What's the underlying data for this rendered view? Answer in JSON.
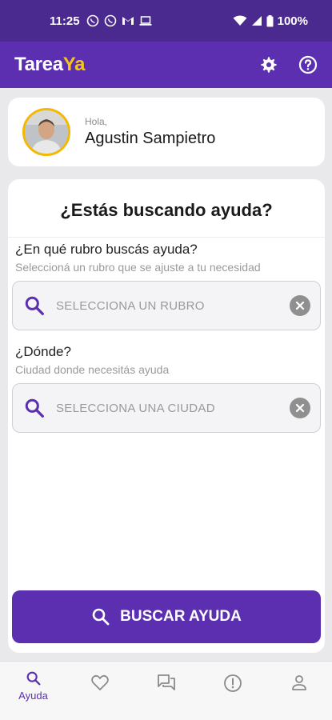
{
  "status_bar": {
    "time": "11:25",
    "battery": "100%"
  },
  "app": {
    "logo_part1": "Tarea",
    "logo_part2": "Ya"
  },
  "greeting": {
    "hola": "Hola,",
    "user_name": "Agustin Sampietro"
  },
  "search": {
    "title": "¿Estás buscando ayuda?",
    "rubro_question": "¿En qué rubro buscás ayuda?",
    "rubro_hint": "Seleccioná un rubro que se ajuste a tu necesidad",
    "rubro_placeholder": "SELECCIONA UN RUBRO",
    "donde_question": "¿Dónde?",
    "donde_hint": "Ciudad donde necesitás ayuda",
    "ciudad_placeholder": "SELECCIONA UNA CIUDAD",
    "button_label": "BUSCAR AYUDA"
  },
  "bottom_nav": {
    "items": [
      {
        "label": "Ayuda",
        "icon": "search-icon",
        "active": true
      },
      {
        "label": "",
        "icon": "heart-icon",
        "active": false
      },
      {
        "label": "",
        "icon": "chat-icon",
        "active": false
      },
      {
        "label": "",
        "icon": "alert-icon",
        "active": false
      },
      {
        "label": "",
        "icon": "person-icon",
        "active": false
      }
    ]
  },
  "colors": {
    "primary": "#5b2fb0",
    "status_bar": "#4a2a8f",
    "accent": "#f5c518"
  }
}
